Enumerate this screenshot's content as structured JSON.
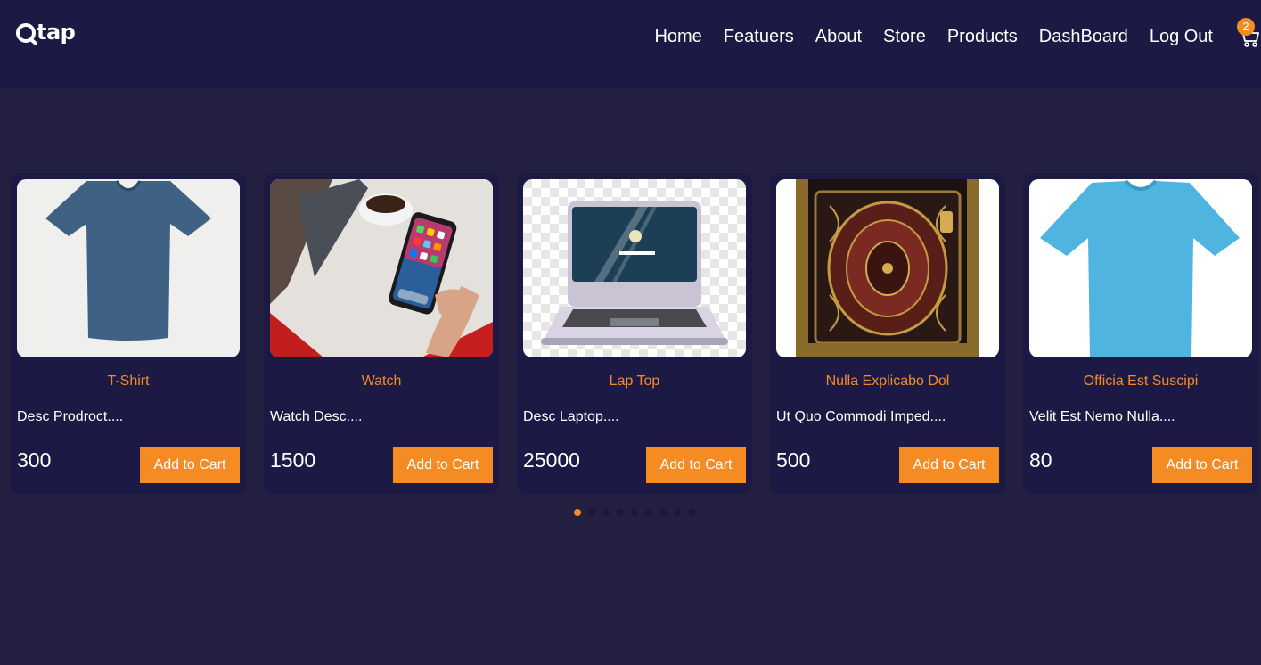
{
  "brand": {
    "name": "tap",
    "accent": "#f58b23",
    "header_bg": "#1c1a45",
    "page_bg": "#231f41"
  },
  "nav": [
    "Home",
    "Featuers",
    "About",
    "Store",
    "Products",
    "DashBoard",
    "Log Out"
  ],
  "cart": {
    "count": "2",
    "icon": "cart-icon"
  },
  "products": [
    {
      "title": "T-Shirt",
      "desc": "Desc Prodroct....",
      "price": "300",
      "button": "Add to Cart",
      "image": "tshirt-image"
    },
    {
      "title": "Watch",
      "desc": "Watch Desc....",
      "price": "1500",
      "button": "Add to Cart",
      "image": "phone-image"
    },
    {
      "title": "Lap Top",
      "desc": "Desc Laptop....",
      "price": "25000",
      "button": "Add to Cart",
      "image": "laptop-image"
    },
    {
      "title": "Nulla Explicabo Dol",
      "desc": "Ut Quo Commodi Imped....",
      "price": "500",
      "button": "Add to Cart",
      "image": "cabinet-image"
    },
    {
      "title": "Officia Est Suscipi",
      "desc": "Velit Est Nemo Nulla....",
      "price": "80",
      "button": "Add to Cart",
      "image": "tshirt-blue-image"
    }
  ],
  "pagination": {
    "total": 9,
    "active": 0
  }
}
